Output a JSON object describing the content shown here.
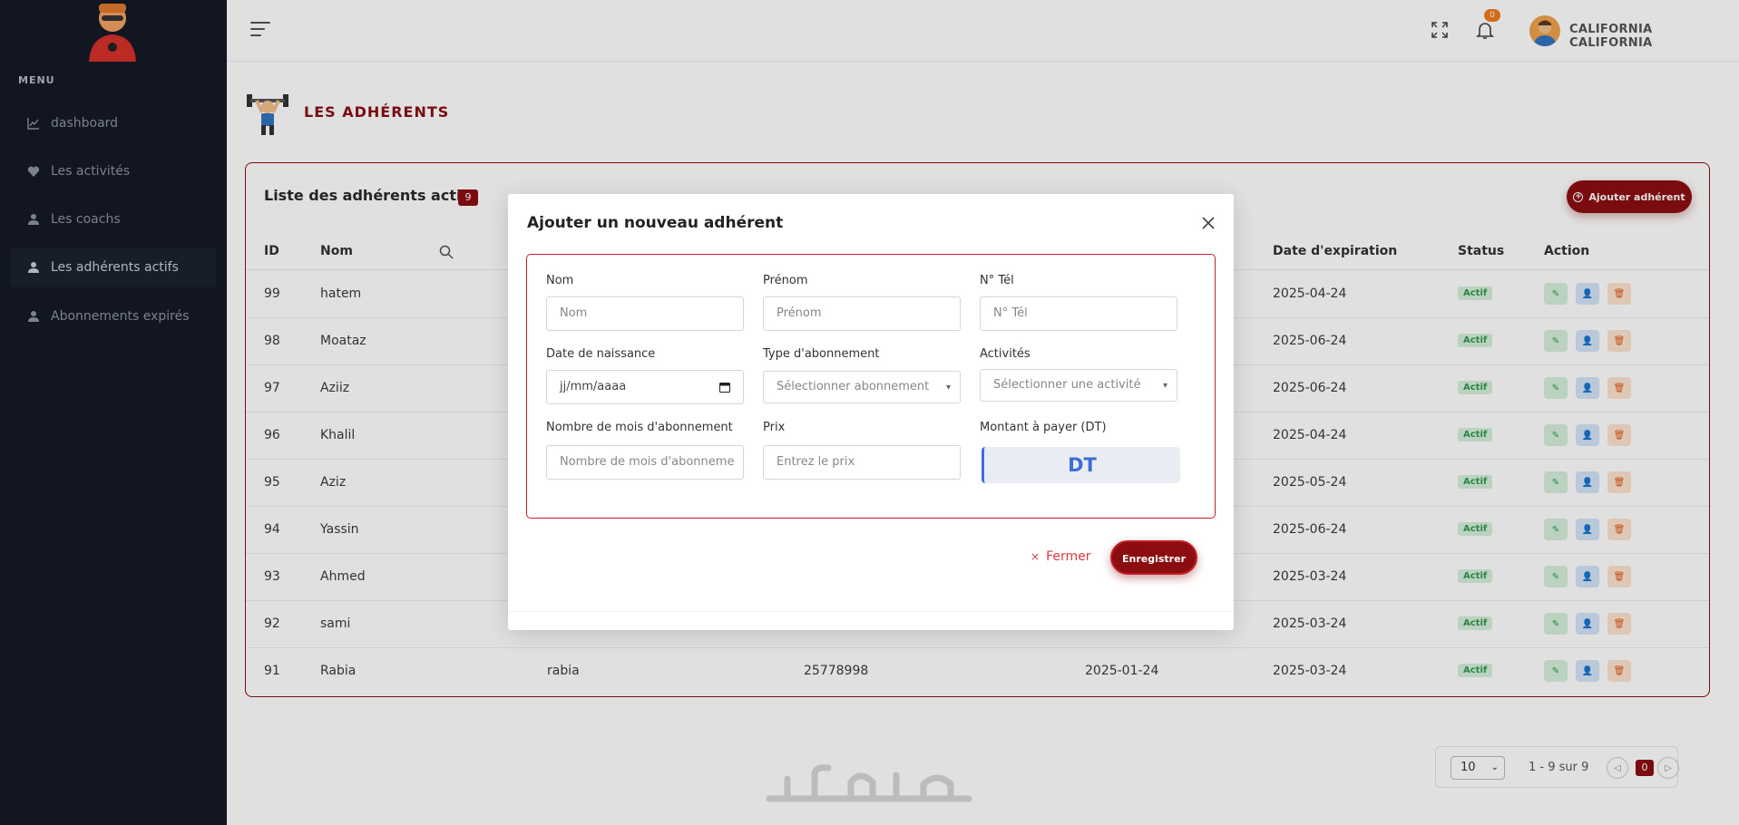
{
  "sidebar": {
    "menu_title": "MENU",
    "items": [
      {
        "label": "dashboard",
        "icon": "chart-line-icon"
      },
      {
        "label": "Les activités",
        "icon": "heart-icon"
      },
      {
        "label": "Les coachs",
        "icon": "user-icon"
      },
      {
        "label": "Les adhérents actifs",
        "icon": "user-icon",
        "active": true
      },
      {
        "label": "Abonnements expirés",
        "icon": "user-icon"
      }
    ]
  },
  "topbar": {
    "notification_count": "0",
    "user_name": "CALIFORNIA CALIFORNIA"
  },
  "page": {
    "title": "LES ADHÉRENTS"
  },
  "table": {
    "title": "Liste des adhérents actifs",
    "count": "9",
    "add_button": "Ajouter adhérent",
    "columns": [
      "ID",
      "Nom",
      "Date d'expiration",
      "Status",
      "Action"
    ],
    "rows": [
      {
        "id": "99",
        "nom": "hatem",
        "prenom": "",
        "tel": "",
        "debut": "",
        "expiration": "2025-04-24",
        "status": "Actif"
      },
      {
        "id": "98",
        "nom": "Moataz",
        "prenom": "",
        "tel": "",
        "debut": "",
        "expiration": "2025-06-24",
        "status": "Actif"
      },
      {
        "id": "97",
        "nom": "Aziiz",
        "prenom": "",
        "tel": "",
        "debut": "",
        "expiration": "2025-06-24",
        "status": "Actif"
      },
      {
        "id": "96",
        "nom": "Khalil",
        "prenom": "",
        "tel": "",
        "debut": "",
        "expiration": "2025-04-24",
        "status": "Actif"
      },
      {
        "id": "95",
        "nom": "Aziz",
        "prenom": "",
        "tel": "",
        "debut": "",
        "expiration": "2025-05-24",
        "status": "Actif"
      },
      {
        "id": "94",
        "nom": "Yassin",
        "prenom": "",
        "tel": "",
        "debut": "",
        "expiration": "2025-06-24",
        "status": "Actif"
      },
      {
        "id": "93",
        "nom": "Ahmed",
        "prenom": "",
        "tel": "",
        "debut": "",
        "expiration": "2025-03-24",
        "status": "Actif"
      },
      {
        "id": "92",
        "nom": "sami",
        "prenom": "",
        "tel": "",
        "debut": "",
        "expiration": "2025-03-24",
        "status": "Actif"
      },
      {
        "id": "91",
        "nom": "Rabia",
        "prenom": "rabia",
        "tel": "25778998",
        "debut": "2025-01-24",
        "expiration": "2025-03-24",
        "status": "Actif"
      }
    ]
  },
  "pagination": {
    "per_page": "10",
    "range": "1 - 9 sur 9",
    "current": "0"
  },
  "modal": {
    "title": "Ajouter un nouveau adhérent",
    "fields": {
      "nom_label": "Nom",
      "nom_placeholder": "Nom",
      "prenom_label": "Prénom",
      "prenom_placeholder": "Prénom",
      "tel_label": "N° Tél",
      "tel_placeholder": "N° Tél",
      "naissance_label": "Date de naissance",
      "naissance_value": "jj/mm/aaaa",
      "type_label": "Type d'abonnement",
      "type_placeholder": "Sélectionner abonnement",
      "activites_label": "Activités",
      "activites_placeholder": "Sélectionner une activité",
      "mois_label": "Nombre de mois d'abonnement",
      "mois_placeholder": "Nombre de mois d'abonneme",
      "prix_label": "Prix",
      "prix_placeholder": "Entrez le prix",
      "montant_label": "Montant à payer (DT)",
      "montant_value": "DT"
    },
    "close_label": "Fermer",
    "save_label": "Enregistrer"
  },
  "colors": {
    "brand": "#8b0d10",
    "sidebar_bg": "#141a25",
    "accent_blue": "#3c6fd6",
    "status_green": "#2e9a4b"
  }
}
